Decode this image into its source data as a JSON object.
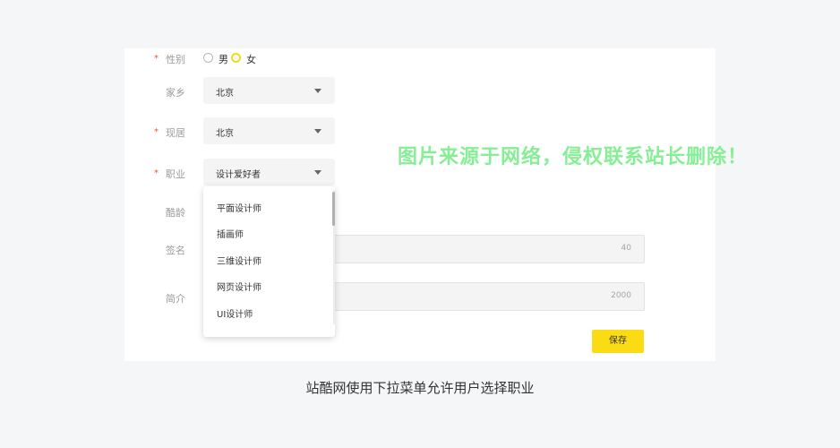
{
  "form": {
    "required_mark": "*",
    "gender": {
      "label": "性别",
      "options": [
        {
          "label": "男",
          "checked": false
        },
        {
          "label": "女",
          "checked": true
        }
      ]
    },
    "hometown": {
      "label": "家乡",
      "value": "北京"
    },
    "residence": {
      "label": "现居",
      "value": "北京"
    },
    "occupation": {
      "label": "职业",
      "value": "设计爱好者",
      "dropdown_options": [
        "平面设计师",
        "插画师",
        "三维设计师",
        "网页设计师",
        "UI设计师"
      ]
    },
    "kuling": {
      "label": "酷龄"
    },
    "signature": {
      "label": "签名",
      "max_count": "40"
    },
    "intro": {
      "label": "简介",
      "max_count": "2000"
    },
    "save_label": "保存"
  },
  "colors": {
    "accent": "#fadb14",
    "required": "#e8543a",
    "watermark": "#86ee94"
  },
  "watermark": "图片来源于网络，侵权联系站长删除！",
  "caption": "站酷网使用下拉菜单允许用户选择职业"
}
